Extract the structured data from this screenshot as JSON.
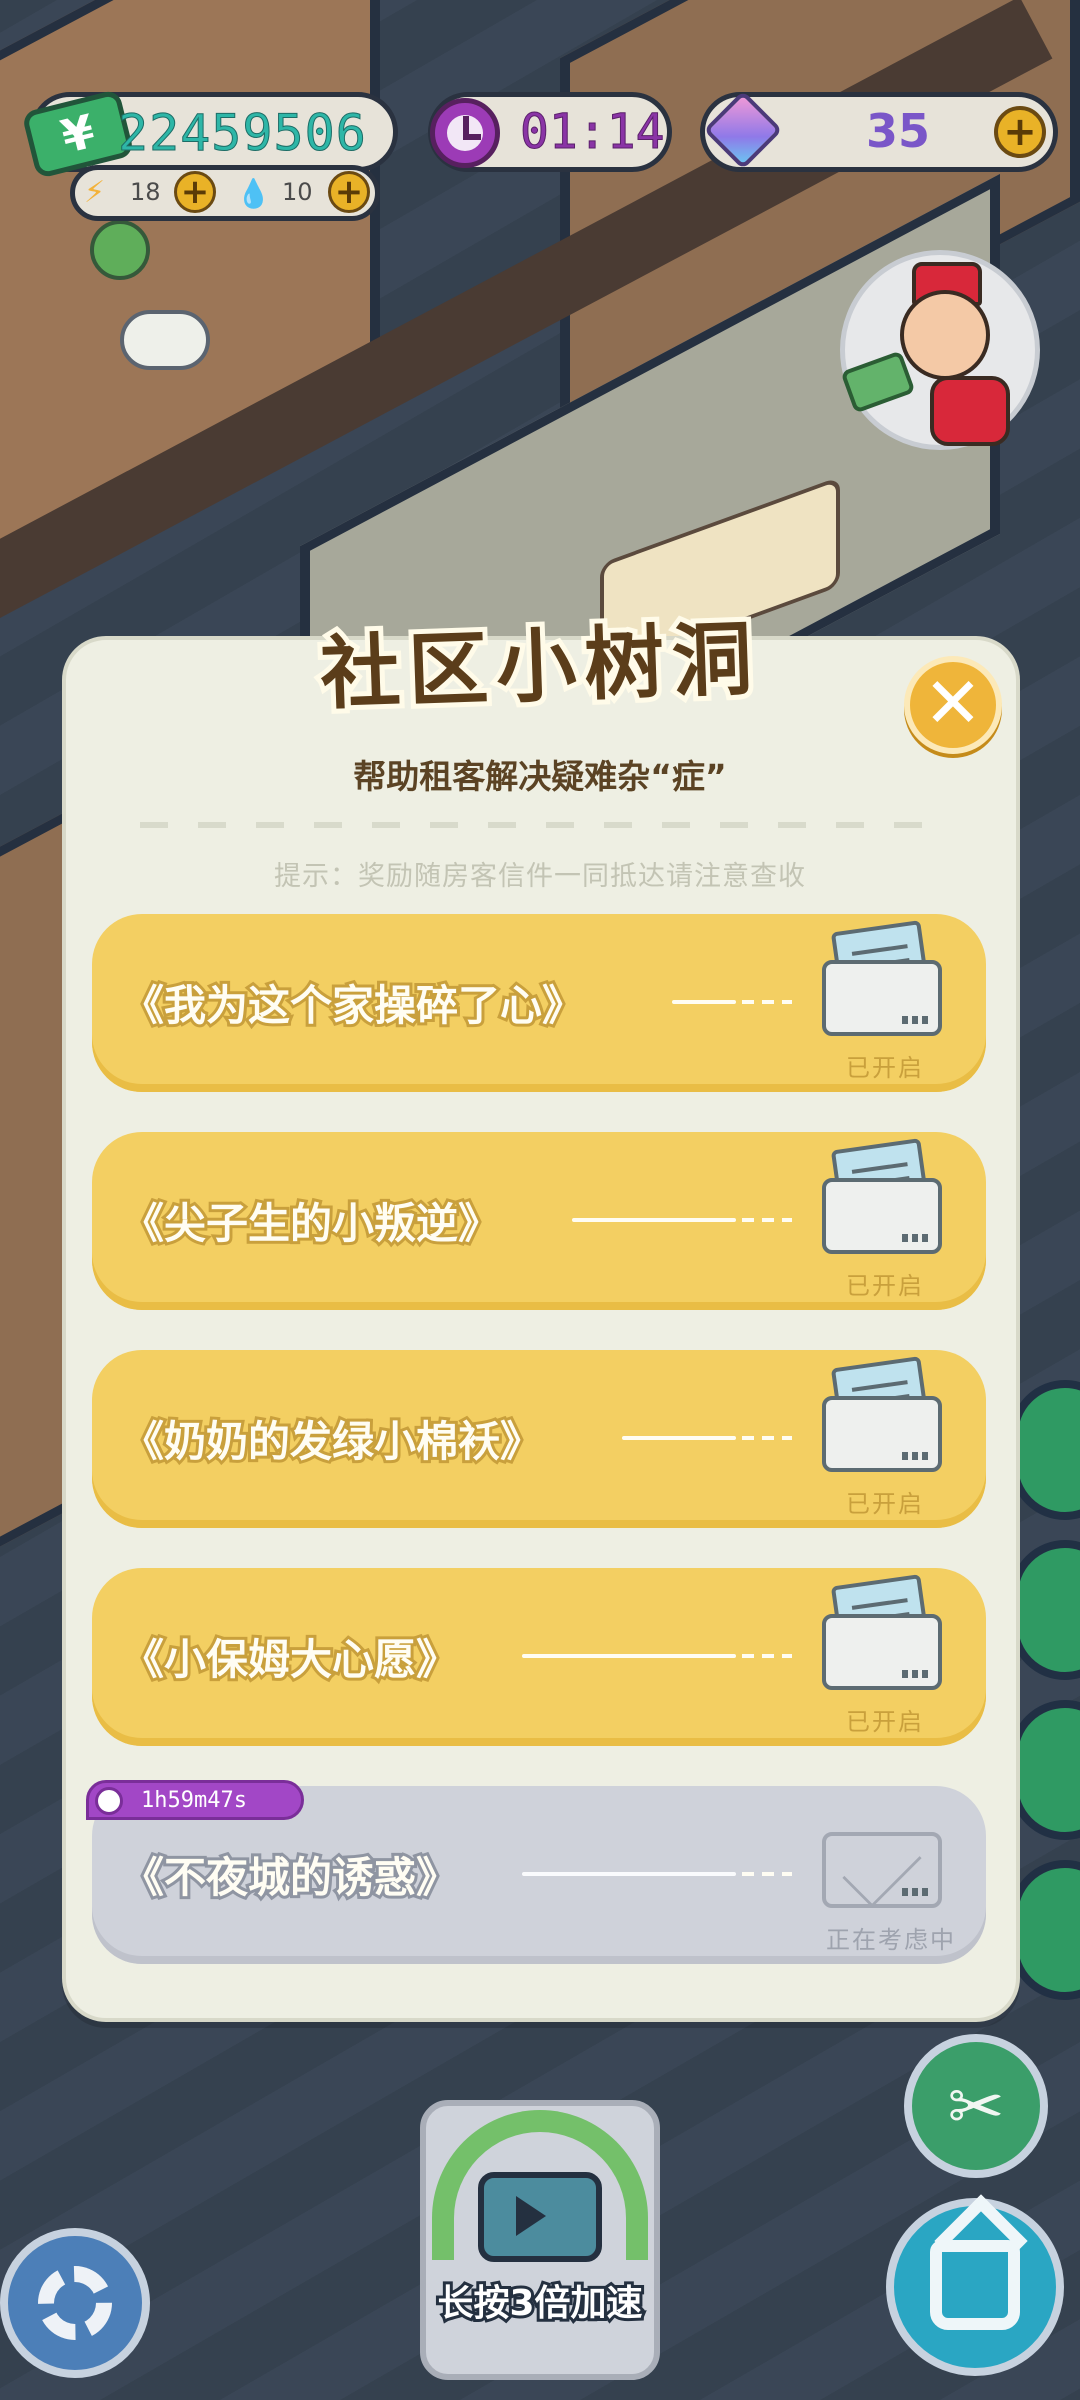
{
  "hud": {
    "money": "22459506",
    "money_icon": "¥",
    "energy": "18",
    "water": "10",
    "timer": "01:14",
    "gems": "35",
    "plus": "+"
  },
  "dialog": {
    "title": "社区小树洞",
    "subtitle": "帮助租客解决疑难杂“症”",
    "hint": "提示：奖励随房客信件一同抵达请注意查收",
    "close": "✕",
    "letters": [
      {
        "title": "《我为这个家操碎了心》",
        "status": "已开启",
        "state": "open"
      },
      {
        "title": "《尖子生的小叛逆》",
        "status": "已开启",
        "state": "open"
      },
      {
        "title": "《奶奶的发绿小棉袄》",
        "status": "已开启",
        "state": "open"
      },
      {
        "title": "《小保姆大心愿》",
        "status": "已开启",
        "state": "open"
      },
      {
        "title": "《不夜城的诱惑》",
        "status": "正在考虑中",
        "state": "pending",
        "countdown": "1h59m47s"
      }
    ]
  },
  "controls": {
    "speed_up_label": "长按3倍加速",
    "tools_glyph": "✂"
  },
  "colors": {
    "card_open": "#f3cf62",
    "card_pending": "#cfd2da",
    "dialog_bg": "#eeefe3",
    "close_btn": "#efb53a",
    "timer_badge": "#a247c6"
  }
}
